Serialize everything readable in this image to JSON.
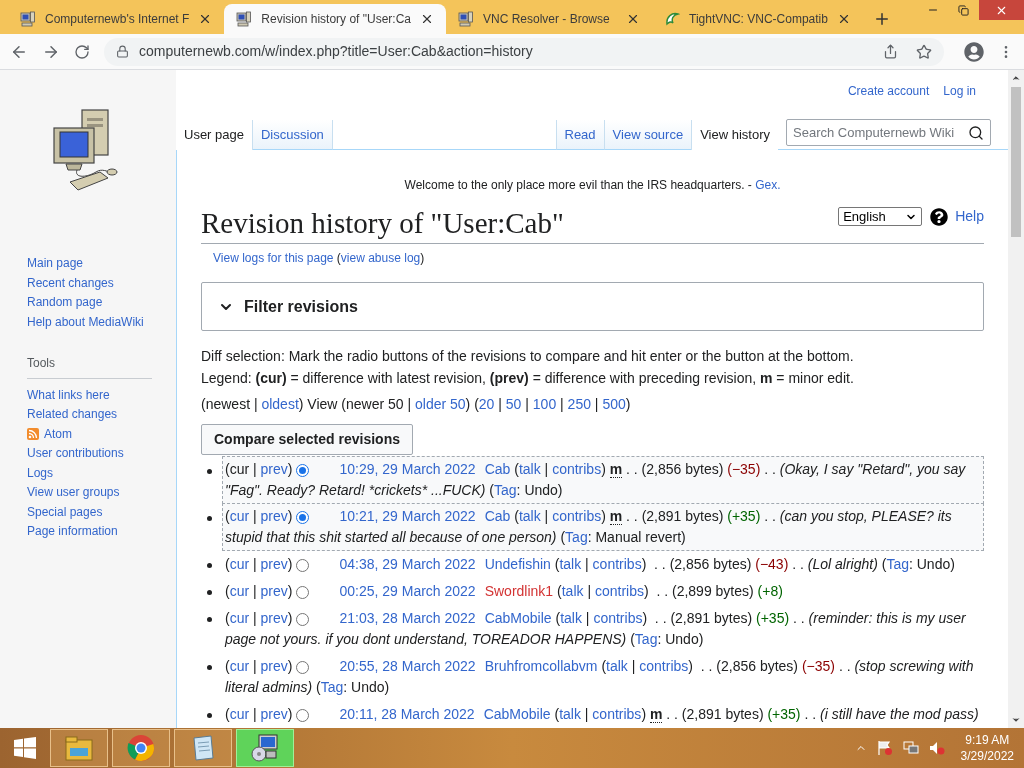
{
  "browser": {
    "tabs": [
      {
        "title": "Computernewb's Internet F",
        "kind": "computer",
        "selected": false
      },
      {
        "title": "Revision history of \"User:Ca",
        "kind": "computer",
        "selected": true
      },
      {
        "title": "VNC Resolver - Browse",
        "kind": "computer",
        "selected": false
      },
      {
        "title": "TightVNC: VNC-Compatib",
        "kind": "tightvnc",
        "selected": false
      }
    ],
    "url": "computernewb.com/w/index.php?title=User:Cab&action=history"
  },
  "personal_links": [
    "Create account",
    "Log in"
  ],
  "page_tabs_left": [
    {
      "label": "User page",
      "selected": true
    },
    {
      "label": "Discussion",
      "selected": false
    }
  ],
  "page_tabs_right": [
    {
      "label": "Read",
      "selected": false
    },
    {
      "label": "View source",
      "selected": false
    },
    {
      "label": "View history",
      "selected": true
    }
  ],
  "search": {
    "placeholder": "Search Computernewb Wiki"
  },
  "sidebar": {
    "navigation": [
      {
        "label": "Main page"
      },
      {
        "label": "Recent changes"
      },
      {
        "label": "Random page"
      },
      {
        "label": "Help about MediaWiki"
      }
    ],
    "tools_heading": "Tools",
    "tools": [
      {
        "label": "What links here",
        "kind": "link"
      },
      {
        "label": "Related changes",
        "kind": "link"
      },
      {
        "label": "Atom",
        "kind": "feed"
      },
      {
        "label": "User contributions",
        "kind": "link"
      },
      {
        "label": "Logs",
        "kind": "link"
      },
      {
        "label": "View user groups",
        "kind": "link"
      },
      {
        "label": "Special pages",
        "kind": "link"
      },
      {
        "label": "Page information",
        "kind": "link"
      }
    ]
  },
  "sitenotice": {
    "text": "Welcome to the only place more evil than the IRS headquarters. - ",
    "link": "Gex."
  },
  "title": "Revision history of \"User:Cab\"",
  "language": "English",
  "help": "Help",
  "subtitle": [
    {
      "kind": "link",
      "text": "View logs for this page"
    },
    {
      "kind": "plain",
      "text": " ("
    },
    {
      "kind": "link",
      "text": "view abuse log"
    },
    {
      "kind": "plain",
      "text": ")"
    }
  ],
  "filter": {
    "label": "Filter revisions",
    "expanded": false
  },
  "diff_selection": "Diff selection: Mark the radio buttons of the revisions to compare and hit enter or the button at the bottom.",
  "legend": "Legend: **(cur)** = difference with latest revision, **(prev)** = difference with preceding revision, **m** = minor edit.",
  "paging": [
    {
      "kind": "plain",
      "text": "(newest | "
    },
    {
      "kind": "link",
      "text": "oldest"
    },
    {
      "kind": "plain",
      "text": ") View (newer 50 | "
    },
    {
      "kind": "link",
      "text": "older 50"
    },
    {
      "kind": "plain",
      "text": ") ("
    },
    {
      "kind": "link",
      "text": "20"
    },
    {
      "kind": "plain",
      "text": " | "
    },
    {
      "kind": "link",
      "text": "50"
    },
    {
      "kind": "plain",
      "text": " | "
    },
    {
      "kind": "link",
      "text": "100"
    },
    {
      "kind": "plain",
      "text": " | "
    },
    {
      "kind": "link",
      "text": "250"
    },
    {
      "kind": "plain",
      "text": " | "
    },
    {
      "kind": "link",
      "text": "500"
    },
    {
      "kind": "plain",
      "text": ")"
    }
  ],
  "compare_button": "Compare selected revisions",
  "revisions": [
    {
      "in_range": true,
      "selected": true,
      "segments": [
        {
          "kind": "plain",
          "text": "(cur | "
        },
        {
          "kind": "link",
          "text": "prev"
        },
        {
          "kind": "plain",
          "text": ")"
        },
        {
          "kind": "radio"
        },
        {
          "kind": "time",
          "text": "10:29, 29 March 2022"
        },
        {
          "kind": "link",
          "text": "Cab"
        },
        {
          "kind": "plain",
          "text": " ("
        },
        {
          "kind": "link",
          "text": "talk"
        },
        {
          "kind": "plain",
          "text": " | "
        },
        {
          "kind": "link",
          "text": "contribs"
        },
        {
          "kind": "plain",
          "text": ") "
        },
        {
          "kind": "minor",
          "text": "m"
        },
        {
          "kind": "plain",
          "text": " . . (2,856 bytes) "
        },
        {
          "kind": "decrease",
          "text": "(−35)"
        },
        {
          "kind": "plain",
          "text": " . . "
        },
        {
          "kind": "summary",
          "text": "(Okay, I say \"Retard\", you say \"Fag\". Ready? Retard! *crickets* ...FUCK)"
        },
        {
          "kind": "plain",
          "text": " ("
        },
        {
          "kind": "link",
          "text": "Tag"
        },
        {
          "kind": "plain",
          "text": ": Undo)"
        }
      ]
    },
    {
      "in_range": true,
      "selected": true,
      "segments": [
        {
          "kind": "plain",
          "text": "("
        },
        {
          "kind": "link",
          "text": "cur"
        },
        {
          "kind": "plain",
          "text": " | "
        },
        {
          "kind": "link",
          "text": "prev"
        },
        {
          "kind": "plain",
          "text": ")"
        },
        {
          "kind": "radio"
        },
        {
          "kind": "time",
          "text": "10:21, 29 March 2022"
        },
        {
          "kind": "link",
          "text": "Cab"
        },
        {
          "kind": "plain",
          "text": " ("
        },
        {
          "kind": "link",
          "text": "talk"
        },
        {
          "kind": "plain",
          "text": " | "
        },
        {
          "kind": "link",
          "text": "contribs"
        },
        {
          "kind": "plain",
          "text": ") "
        },
        {
          "kind": "minor",
          "text": "m"
        },
        {
          "kind": "plain",
          "text": " . . (2,891 bytes) "
        },
        {
          "kind": "increase",
          "text": "(+35)"
        },
        {
          "kind": "plain",
          "text": " . . "
        },
        {
          "kind": "summary",
          "text": "(can you stop, PLEASE? its stupid that this shit started all because of one person)"
        },
        {
          "kind": "plain",
          "text": " ("
        },
        {
          "kind": "link",
          "text": "Tag"
        },
        {
          "kind": "plain",
          "text": ": Manual revert)"
        }
      ]
    },
    {
      "in_range": false,
      "selected": false,
      "segments": [
        {
          "kind": "plain",
          "text": "("
        },
        {
          "kind": "link",
          "text": "cur"
        },
        {
          "kind": "plain",
          "text": " | "
        },
        {
          "kind": "link",
          "text": "prev"
        },
        {
          "kind": "plain",
          "text": ")"
        },
        {
          "kind": "radio"
        },
        {
          "kind": "time",
          "text": "04:38, 29 March 2022"
        },
        {
          "kind": "link",
          "text": "Undefishin"
        },
        {
          "kind": "plain",
          "text": " ("
        },
        {
          "kind": "link",
          "text": "talk"
        },
        {
          "kind": "plain",
          "text": " | "
        },
        {
          "kind": "link",
          "text": "contribs"
        },
        {
          "kind": "plain",
          "text": ")  . . (2,856 bytes) "
        },
        {
          "kind": "decrease",
          "text": "(−43)"
        },
        {
          "kind": "plain",
          "text": " . . "
        },
        {
          "kind": "summary",
          "text": "(Lol alright)"
        },
        {
          "kind": "plain",
          "text": " ("
        },
        {
          "kind": "link",
          "text": "Tag"
        },
        {
          "kind": "plain",
          "text": ": Undo)"
        }
      ]
    },
    {
      "in_range": false,
      "selected": false,
      "segments": [
        {
          "kind": "plain",
          "text": "("
        },
        {
          "kind": "link",
          "text": "cur"
        },
        {
          "kind": "plain",
          "text": " | "
        },
        {
          "kind": "link",
          "text": "prev"
        },
        {
          "kind": "plain",
          "text": ")"
        },
        {
          "kind": "radio"
        },
        {
          "kind": "time",
          "text": "00:25, 29 March 2022"
        },
        {
          "kind": "redlink",
          "text": "Swordlink1"
        },
        {
          "kind": "plain",
          "text": " ("
        },
        {
          "kind": "link",
          "text": "talk"
        },
        {
          "kind": "plain",
          "text": " | "
        },
        {
          "kind": "link",
          "text": "contribs"
        },
        {
          "kind": "plain",
          "text": ")  . . (2,899 bytes) "
        },
        {
          "kind": "increase",
          "text": "(+8)"
        }
      ]
    },
    {
      "in_range": false,
      "selected": false,
      "segments": [
        {
          "kind": "plain",
          "text": "("
        },
        {
          "kind": "link",
          "text": "cur"
        },
        {
          "kind": "plain",
          "text": " | "
        },
        {
          "kind": "link",
          "text": "prev"
        },
        {
          "kind": "plain",
          "text": ")"
        },
        {
          "kind": "radio"
        },
        {
          "kind": "time",
          "text": "21:03, 28 March 2022"
        },
        {
          "kind": "link",
          "text": "CabMobile"
        },
        {
          "kind": "plain",
          "text": " ("
        },
        {
          "kind": "link",
          "text": "talk"
        },
        {
          "kind": "plain",
          "text": " | "
        },
        {
          "kind": "link",
          "text": "contribs"
        },
        {
          "kind": "plain",
          "text": ")  . . (2,891 bytes) "
        },
        {
          "kind": "increase",
          "text": "(+35)"
        },
        {
          "kind": "plain",
          "text": " . . "
        },
        {
          "kind": "summary",
          "text": "(reminder: this is my user page not yours. if you dont understand, TOREADOR HAPPENS)"
        },
        {
          "kind": "plain",
          "text": " ("
        },
        {
          "kind": "link",
          "text": "Tag"
        },
        {
          "kind": "plain",
          "text": ": Undo)"
        }
      ]
    },
    {
      "in_range": false,
      "selected": false,
      "segments": [
        {
          "kind": "plain",
          "text": "("
        },
        {
          "kind": "link",
          "text": "cur"
        },
        {
          "kind": "plain",
          "text": " | "
        },
        {
          "kind": "link",
          "text": "prev"
        },
        {
          "kind": "plain",
          "text": ")"
        },
        {
          "kind": "radio"
        },
        {
          "kind": "time",
          "text": "20:55, 28 March 2022"
        },
        {
          "kind": "link",
          "text": "Bruhfromcollabvm"
        },
        {
          "kind": "plain",
          "text": " ("
        },
        {
          "kind": "link",
          "text": "talk"
        },
        {
          "kind": "plain",
          "text": " | "
        },
        {
          "kind": "link",
          "text": "contribs"
        },
        {
          "kind": "plain",
          "text": ")  . . (2,856 bytes) "
        },
        {
          "kind": "decrease",
          "text": "(−35)"
        },
        {
          "kind": "plain",
          "text": " . . "
        },
        {
          "kind": "summary",
          "text": "(stop screwing with literal admins)"
        },
        {
          "kind": "plain",
          "text": " ("
        },
        {
          "kind": "link",
          "text": "Tag"
        },
        {
          "kind": "plain",
          "text": ": Undo)"
        }
      ]
    },
    {
      "in_range": false,
      "selected": false,
      "segments": [
        {
          "kind": "plain",
          "text": "("
        },
        {
          "kind": "link",
          "text": "cur"
        },
        {
          "kind": "plain",
          "text": " | "
        },
        {
          "kind": "link",
          "text": "prev"
        },
        {
          "kind": "plain",
          "text": ")"
        },
        {
          "kind": "radio"
        },
        {
          "kind": "time",
          "text": "20:11, 28 March 2022"
        },
        {
          "kind": "link",
          "text": "CabMobile"
        },
        {
          "kind": "plain",
          "text": " ("
        },
        {
          "kind": "link",
          "text": "talk"
        },
        {
          "kind": "plain",
          "text": " | "
        },
        {
          "kind": "link",
          "text": "contribs"
        },
        {
          "kind": "plain",
          "text": ") "
        },
        {
          "kind": "minor",
          "text": "m"
        },
        {
          "kind": "plain",
          "text": " . . (2,891 bytes) "
        },
        {
          "kind": "increase",
          "text": "(+35)"
        },
        {
          "kind": "plain",
          "text": " . . "
        },
        {
          "kind": "summary",
          "text": "(i still have the mod pass)"
        }
      ]
    }
  ],
  "taskbar": {
    "apps": [
      {
        "kind": "explorer",
        "selected": false
      },
      {
        "kind": "chrome",
        "selected": false
      },
      {
        "kind": "notepad",
        "selected": false
      },
      {
        "kind": "program",
        "selected": true
      }
    ],
    "time": "9:19 AM",
    "date": "3/29/2022"
  }
}
